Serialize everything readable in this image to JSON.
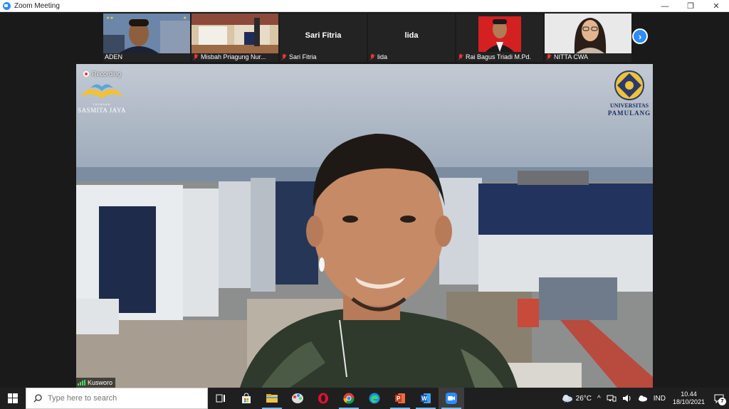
{
  "window": {
    "title": "Zoom Meeting",
    "minimize": "—",
    "restore": "❐",
    "close": "✕"
  },
  "participants": [
    {
      "name": "ADEN",
      "muted": false,
      "video": true
    },
    {
      "name": "Misbah Priagung Nur...",
      "muted": true,
      "video": true
    },
    {
      "name": "Sari Fitria",
      "muted": true,
      "video": false
    },
    {
      "name": "lida",
      "muted": true,
      "video": false
    },
    {
      "name": "Rai Bagus Triadi M.Pd.",
      "muted": true,
      "video": true
    },
    {
      "name": "NITTA CWA",
      "muted": true,
      "video": true
    }
  ],
  "main": {
    "recording_label": "Recording",
    "speaker_name": "Kusworo",
    "logo_left": {
      "top": "YAYASAN",
      "bottom": "SASMITA JAYA"
    },
    "logo_right": {
      "line1": "UNIVERSITAS",
      "line2": "PAMULANG"
    }
  },
  "next_page_icon": "chevron-right-icon",
  "taskbar": {
    "search_placeholder": "Type here to search",
    "apps": [
      "task-view-icon",
      "store-icon",
      "file-explorer-icon",
      "paint-icon",
      "opera-icon",
      "chrome-icon",
      "edge-icon",
      "powerpoint-icon",
      "word-icon",
      "zoom-icon"
    ],
    "weather": "26°C",
    "language": "IND",
    "time": "10.44",
    "date": "18/10/2021",
    "notifications": "7"
  },
  "colors": {
    "zoom_blue": "#2d8cff",
    "muted_red": "#e33333",
    "taskbar": "#1f1f1f"
  }
}
